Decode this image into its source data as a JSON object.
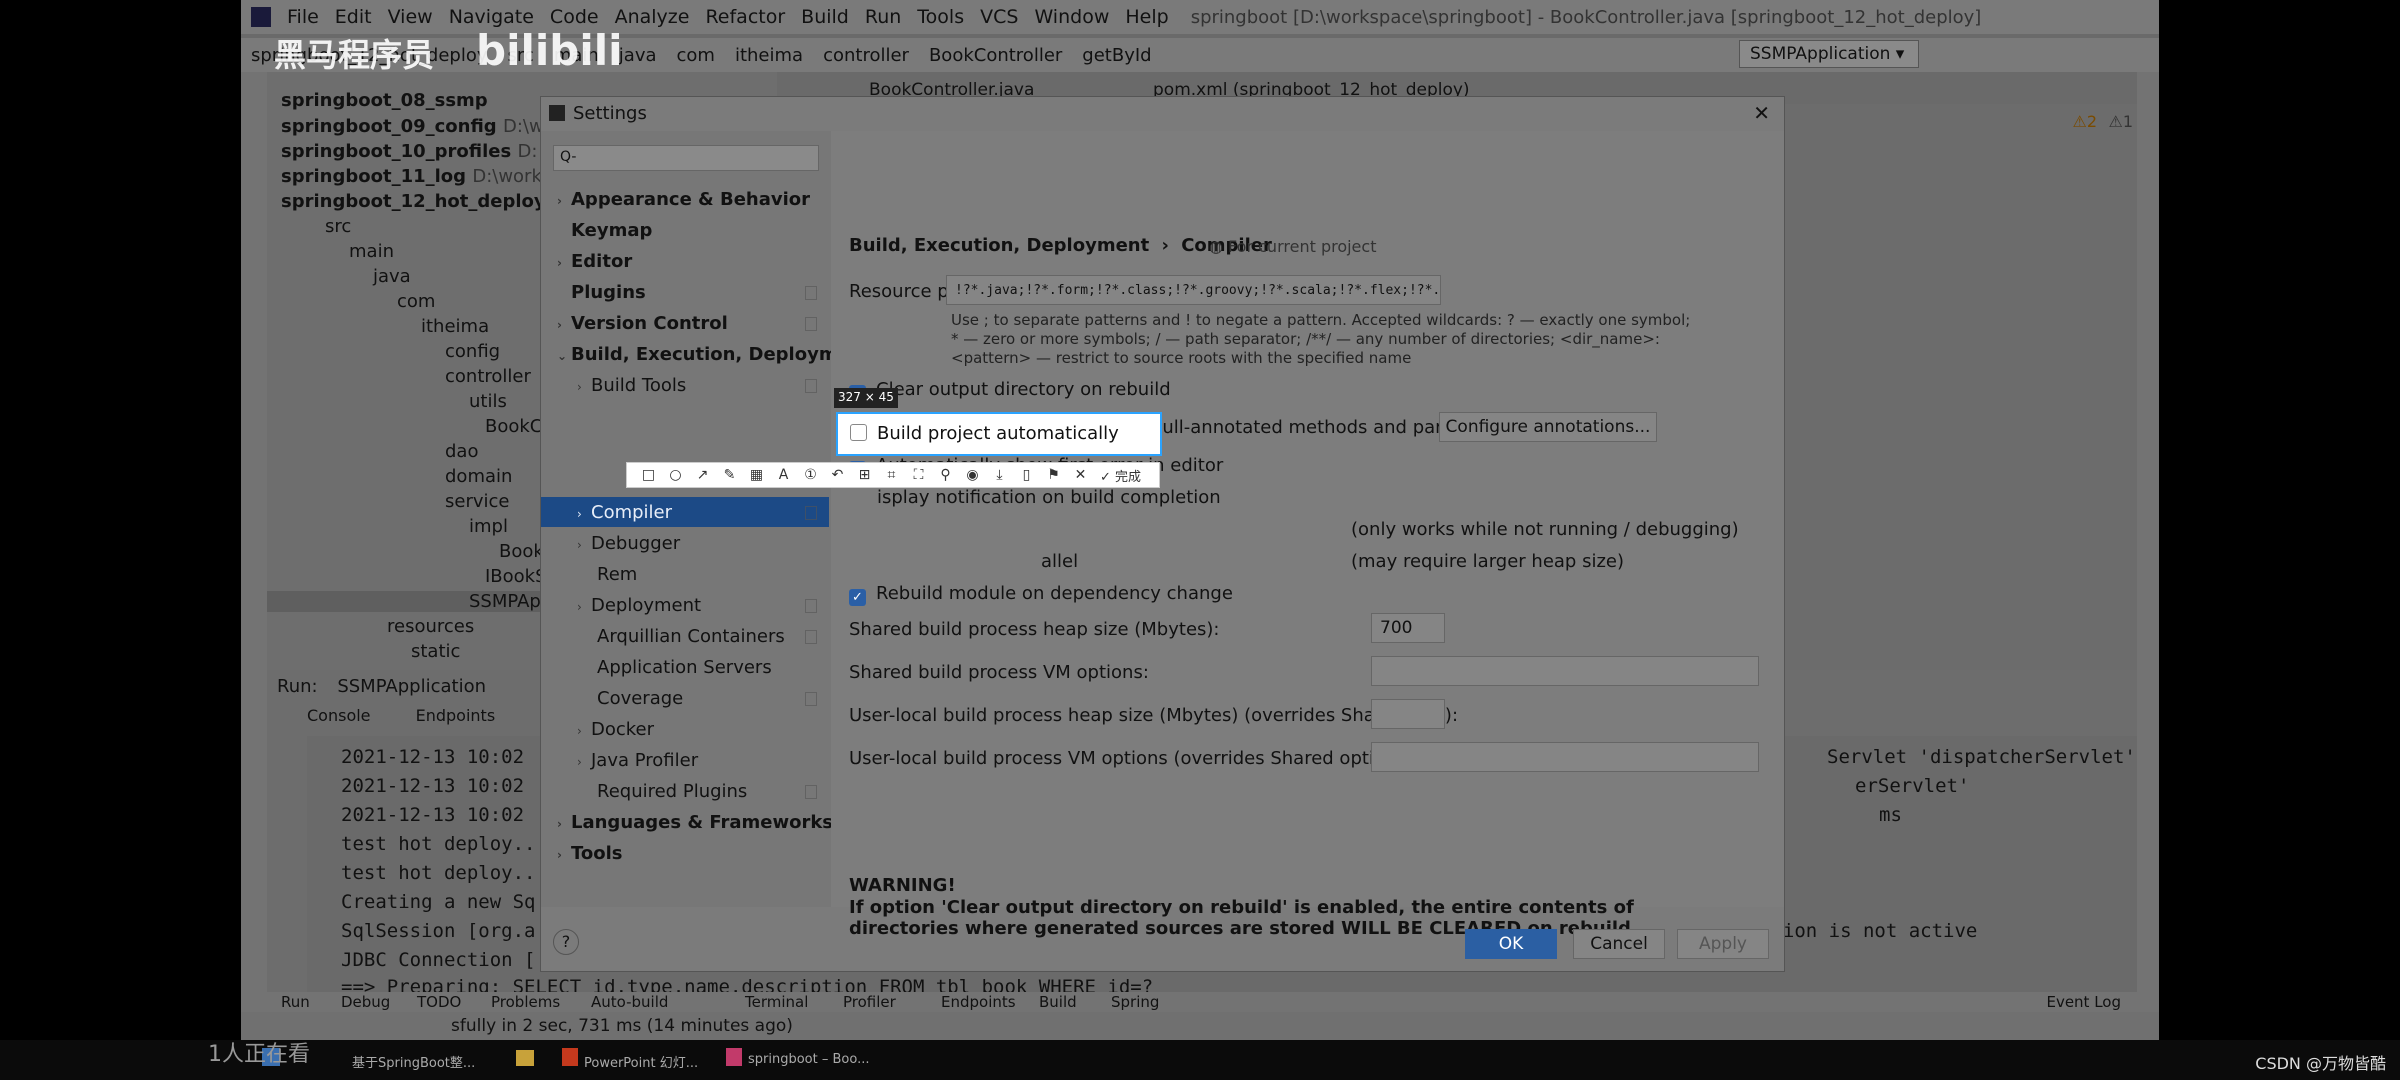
{
  "watermark": {
    "brand_cn": "黑马程序员",
    "brand_en": "bilibili"
  },
  "menu": [
    "File",
    "Edit",
    "View",
    "Navigate",
    "Code",
    "Analyze",
    "Refactor",
    "Build",
    "Run",
    "Tools",
    "VCS",
    "Window",
    "Help"
  ],
  "window_title": "springboot [D:\\workspace\\springboot] - BookController.java [springboot_12_hot_deploy]",
  "breadcrumbs": [
    "springboot_12_hot_deploy",
    "src",
    "main",
    "java",
    "com",
    "itheima",
    "controller",
    "BookController",
    "getById"
  ],
  "run_config": "SSMPApplication",
  "editor_tabs": [
    "BookController.java",
    "pom.xml (springboot_12_hot_deploy)"
  ],
  "inspection": {
    "warnings": "⚠2",
    "weak": "⚠1"
  },
  "project_tree": [
    {
      "label": "springboot_08_ssmp",
      "bold": true
    },
    {
      "label": "springboot_09_config",
      "extra": "D:\\w",
      "bold": true
    },
    {
      "label": "springboot_10_profiles",
      "extra": "D:",
      "bold": true
    },
    {
      "label": "springboot_11_log",
      "extra": "D:\\work",
      "bold": true
    },
    {
      "label": "springboot_12_hot_deploy",
      "bold": true
    },
    {
      "label": "src"
    },
    {
      "label": "main"
    },
    {
      "label": "java"
    },
    {
      "label": "com"
    },
    {
      "label": "itheima"
    },
    {
      "label": "config"
    },
    {
      "label": "controller"
    },
    {
      "label": "utils"
    },
    {
      "label": "BookCo"
    },
    {
      "label": "dao"
    },
    {
      "label": "domain"
    },
    {
      "label": "service"
    },
    {
      "label": "impl"
    },
    {
      "label": "Book"
    },
    {
      "label": "IBookS"
    },
    {
      "label": "SSMPApplic"
    },
    {
      "label": "resources"
    },
    {
      "label": "static"
    }
  ],
  "run_panel": {
    "label": "Run:",
    "config": "SSMPApplication",
    "tabs": [
      "Console",
      "Endpoints"
    ],
    "lines": [
      "2021-12-13 10:02",
      "2021-12-13 10:02",
      "2021-12-13 10:02",
      "test hot deploy..",
      "test hot deploy..",
      "Creating a new Sq",
      "SqlSession [org.a",
      "JDBC Connection [",
      "==>  Preparing: SELECT id,type,name,description FROM tbl_book WHERE id=?"
    ],
    "right_lines": [
      "Servlet 'dispatcherServlet'",
      "erServlet'",
      "ms",
      "ation is not active"
    ]
  },
  "bottom_tools": [
    "Run",
    "Debug",
    "TODO",
    "Problems",
    "Auto-build",
    "Terminal",
    "Profiler",
    "Endpoints",
    "Build",
    "Spring"
  ],
  "event_log": "Event Log",
  "status_text": "sfully in 2 sec, 731 ms (14 minutes ago)",
  "dialog": {
    "title": "Settings",
    "search_placeholder": "Q-",
    "tree": [
      {
        "label": "Appearance & Behavior",
        "bold": true,
        "chev": "›"
      },
      {
        "label": "Keymap",
        "bold": true
      },
      {
        "label": "Editor",
        "bold": true,
        "chev": "›"
      },
      {
        "label": "Plugins",
        "bold": true
      },
      {
        "label": "Version Control",
        "bold": true,
        "chev": "›"
      },
      {
        "label": "Build, Execution, Deployment",
        "bold": true,
        "chev": "⌄"
      },
      {
        "label": "Build Tools",
        "chev": "›",
        "indent": 1
      },
      {
        "label": "Compiler",
        "chev": "›",
        "indent": 1,
        "selected": true
      },
      {
        "label": "Debugger",
        "chev": "›",
        "indent": 1
      },
      {
        "label": "Rem",
        "indent": 1
      },
      {
        "label": "Deployment",
        "chev": "›",
        "indent": 1
      },
      {
        "label": "Arquillian Containers",
        "indent": 1
      },
      {
        "label": "Application Servers",
        "indent": 1
      },
      {
        "label": "Coverage",
        "indent": 1
      },
      {
        "label": "Docker",
        "chev": "›",
        "indent": 1
      },
      {
        "label": "Java Profiler",
        "chev": "›",
        "indent": 1
      },
      {
        "label": "Required Plugins",
        "indent": 1
      },
      {
        "label": "Languages & Frameworks",
        "bold": true,
        "chev": "›"
      },
      {
        "label": "Tools",
        "bold": true,
        "chev": "›"
      }
    ],
    "breadcrumb": [
      "Build, Execution, Deployment",
      "Compiler"
    ],
    "for_current_project": "For current project",
    "resource_label": "Resource patterns:",
    "resource_value": "!?*.java;!?*.form;!?*.class;!?*.groovy;!?*.scala;!?*.flex;!?*.kt;!?*.clj;!?*.aj",
    "resource_hint": "Use ; to separate patterns and ! to negate a pattern. Accepted wildcards: ? — exactly one symbol; * — zero or more symbols; / — path separator; /**/ — any number of directories; <dir_name>:<pattern> — restrict to source roots with the specified name",
    "options": [
      {
        "label": "Clear output directory on rebuild",
        "checked": true
      },
      {
        "label": "Add runtime assertions for notnull-annotated methods and parameters",
        "checked": true
      },
      {
        "label": "Automatically show first error in editor",
        "checked": true
      },
      {
        "label": "isplay notification on build completion",
        "checked": true
      },
      {
        "label": "allel",
        "checked": true
      },
      {
        "label": "Rebuild module on dependency change",
        "checked": true
      }
    ],
    "configure_button": "Configure annotations...",
    "note_running": "(only works while not running / debugging)",
    "note_heap": "(may require larger heap size)",
    "heap_label": "Shared build process heap size (Mbytes):",
    "heap_value": "700",
    "vm_label": "Shared build process VM options:",
    "vm_value": "",
    "user_heap_label": "User-local build process heap size (Mbytes) (overrides Shared size):",
    "user_heap_value": "",
    "user_vm_label": "User-local build process VM options (overrides Shared options):",
    "user_vm_value": "",
    "warning_title": "WARNING!",
    "warning_body": "If option 'Clear output directory on rebuild' is enabled, the entire contents of directories where generated sources are stored WILL BE CLEARED on rebuild.",
    "buttons": {
      "ok": "OK",
      "cancel": "Cancel",
      "apply": "Apply"
    },
    "help": "?"
  },
  "capture": {
    "size": "327 × 45",
    "selected_label": "Build project automatically",
    "selected_checked": false,
    "done_label": "完成"
  },
  "taskbar": [
    "基于SpringBoot整...",
    "",
    "PowerPoint 幻灯...",
    "springboot – Boo..."
  ],
  "viewer_text": "1人正在看",
  "credit": "CSDN @万物皆酷"
}
